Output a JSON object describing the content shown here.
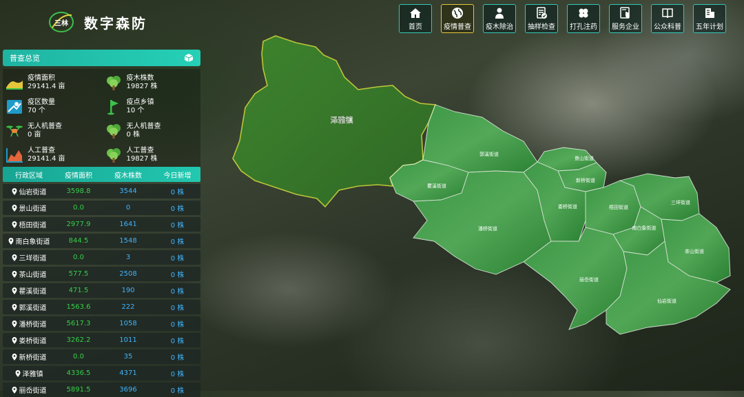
{
  "header": {
    "title": "数字森防",
    "logo_text": "三林"
  },
  "nav": [
    {
      "label": "首页",
      "icon": "home-icon",
      "active": false
    },
    {
      "label": "疫情普查",
      "icon": "globe-icon",
      "active": true
    },
    {
      "label": "疫木除治",
      "icon": "worker-icon",
      "active": false
    },
    {
      "label": "抽样检查",
      "icon": "checklist-icon",
      "active": false
    },
    {
      "label": "打孔注药",
      "icon": "clover-icon",
      "active": false
    },
    {
      "label": "服务企业",
      "icon": "shield-doc-icon",
      "active": false
    },
    {
      "label": "公众科普",
      "icon": "book-icon",
      "active": false
    },
    {
      "label": "五年计划",
      "icon": "building-icon",
      "active": false
    }
  ],
  "panel": {
    "title": "普查总览",
    "stats": [
      {
        "label": "疫情面积",
        "value": "29141.4 亩",
        "icon": "terrain-icon"
      },
      {
        "label": "疫木株数",
        "value": "19827 株",
        "icon": "tree-icon"
      },
      {
        "label": "疫区数量",
        "value": "70 个",
        "icon": "map-icon"
      },
      {
        "label": "疫点乡镇",
        "value": "10 个",
        "icon": "flag-icon"
      },
      {
        "label": "无人机普查",
        "value": "0 亩",
        "icon": "drone-icon"
      },
      {
        "label": "无人机普查",
        "value": "0 株",
        "icon": "tree-icon"
      },
      {
        "label": "人工普查",
        "value": "29141.4 亩",
        "icon": "area-chart-icon"
      },
      {
        "label": "人工普查",
        "value": "19827 株",
        "icon": "tree-icon"
      }
    ],
    "table": {
      "headers": [
        "行政区域",
        "疫情面积",
        "疫木株数",
        "今日新增"
      ],
      "rows": [
        {
          "region": "仙岩街道",
          "area": "3598.8",
          "trees": "3544",
          "today": "0 株"
        },
        {
          "region": "景山街道",
          "area": "0.0",
          "trees": "0",
          "today": "0 株"
        },
        {
          "region": "梧田街道",
          "area": "2977.9",
          "trees": "1641",
          "today": "0 株"
        },
        {
          "region": "南白象街道",
          "area": "844.5",
          "trees": "1548",
          "today": "0 株"
        },
        {
          "region": "三垟街道",
          "area": "0.0",
          "trees": "3",
          "today": "0 株"
        },
        {
          "region": "茶山街道",
          "area": "577.5",
          "trees": "2508",
          "today": "0 株"
        },
        {
          "region": "瞿溪街道",
          "area": "471.5",
          "trees": "190",
          "today": "0 株"
        },
        {
          "region": "郭溪街道",
          "area": "1563.6",
          "trees": "222",
          "today": "0 株"
        },
        {
          "region": "潘桥街道",
          "area": "5617.3",
          "trees": "1058",
          "today": "0 株"
        },
        {
          "region": "娄桥街道",
          "area": "3262.2",
          "trees": "1011",
          "today": "0 株"
        },
        {
          "region": "新桥街道",
          "area": "0.0",
          "trees": "35",
          "today": "0 株"
        },
        {
          "region": "泽雅镇",
          "area": "4336.5",
          "trees": "4371",
          "today": "0 株"
        },
        {
          "region": "丽岙街道",
          "area": "5891.5",
          "trees": "3696",
          "today": "0 株"
        }
      ]
    }
  },
  "map": {
    "highlighted_region": "泽雅镇",
    "region_labels": [
      "郭溪街道",
      "景山街道",
      "新桥街道",
      "瞿溪街道",
      "梧田街道",
      "娄桥街道",
      "三垟街道",
      "潘桥街道",
      "南白象街道",
      "茶山街道",
      "丽岙街道",
      "仙岩街道"
    ]
  },
  "colors": {
    "accent": "#25d0b6",
    "active_border": "#e7c83a",
    "area_text": "#37d04a",
    "tree_text": "#3fb4ff",
    "highlight_outline": "#c8d23a"
  }
}
